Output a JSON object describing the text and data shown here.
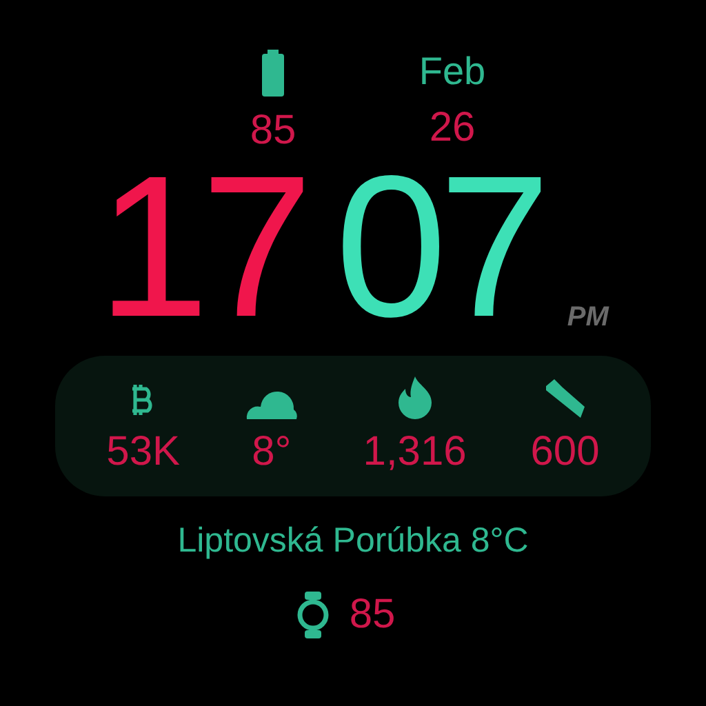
{
  "battery": {
    "value": "85"
  },
  "date": {
    "month": "Feb",
    "day": "26"
  },
  "time": {
    "hours": "17",
    "minutes": "07",
    "period": "PM"
  },
  "stats": [
    {
      "kind": "bitcoin",
      "value": "53K"
    },
    {
      "kind": "weather",
      "value": "8°"
    },
    {
      "kind": "calories",
      "value": "1,316"
    },
    {
      "kind": "steps",
      "value": "600"
    }
  ],
  "location": "Liptovská Porúbka 8°C",
  "watch_battery": {
    "value": "85"
  }
}
